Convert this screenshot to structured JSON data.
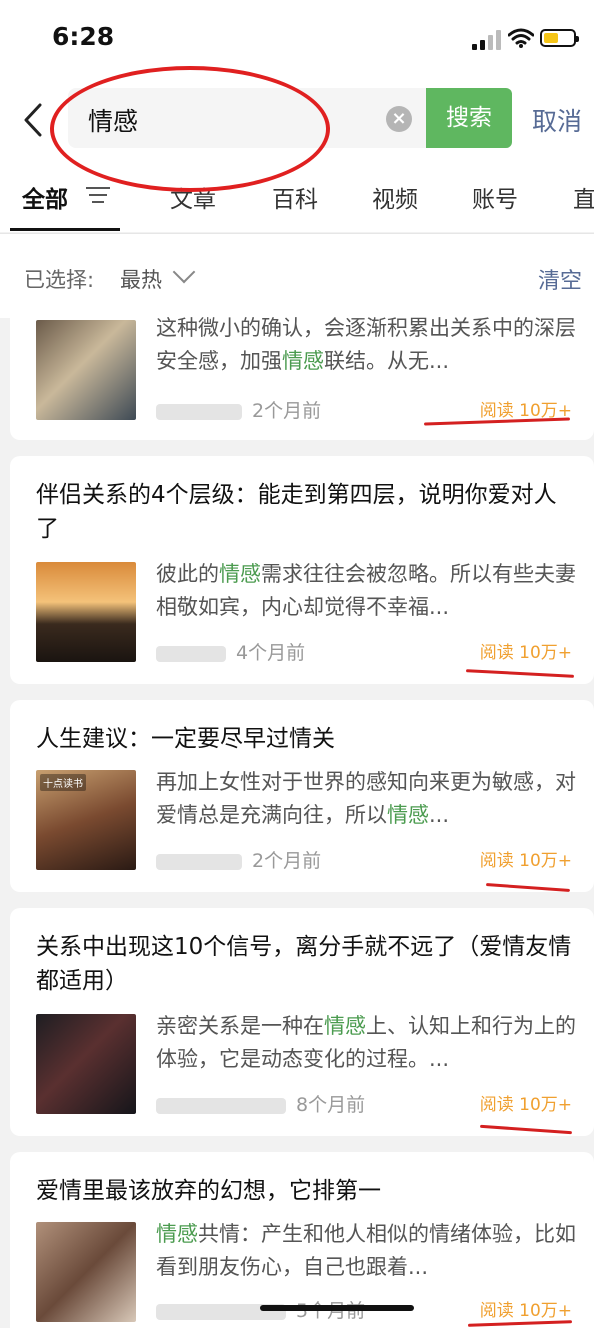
{
  "status": {
    "time": "6:28"
  },
  "search": {
    "query": "情感",
    "search_label": "搜索",
    "cancel_label": "取消"
  },
  "tabs": [
    {
      "label": "全部"
    },
    {
      "label": "文章"
    },
    {
      "label": "百科"
    },
    {
      "label": "视频"
    },
    {
      "label": "账号"
    },
    {
      "label": "直"
    }
  ],
  "filter": {
    "selected_label": "已选择:",
    "selected_value": "最热",
    "clear_label": "清空"
  },
  "results": [
    {
      "title": "",
      "snippet_pre": "这种微小的确认，会逐渐积累出关系中的深层安全感，加强",
      "snippet_hl": "情感",
      "snippet_post": "联结。从无...",
      "time": "2个月前",
      "reads": "阅读 10万+"
    },
    {
      "title": "伴侣关系的4个层级：能走到第四层，说明你爱对人了",
      "snippet_pre": "彼此的",
      "snippet_hl": "情感",
      "snippet_post": "需求往往会被忽略。所以有些夫妻相敬如宾，内心却觉得不幸福...",
      "time": "4个月前",
      "reads": "阅读 10万+"
    },
    {
      "title": "人生建议：一定要尽早过情关",
      "snippet_pre": "再加上女性对于世界的感知向来更为敏感，对爱情总是充满向往，所以",
      "snippet_hl": "情感",
      "snippet_post": "...",
      "time": "2个月前",
      "reads": "阅读 10万+",
      "thumb_badge": "十点读书"
    },
    {
      "title": "关系中出现这10个信号，离分手就不远了（爱情友情都适用）",
      "snippet_pre": "亲密关系是一种在",
      "snippet_hl": "情感",
      "snippet_post": "上、认知上和行为上的体验，它是动态变化的过程。...",
      "time": "8个月前",
      "reads": "阅读 10万+"
    },
    {
      "title": "爱情里最该放弃的幻想，它排第一",
      "snippet_pre": "",
      "snippet_hl": "情感",
      "snippet_post": "共情：产生和他人相似的情绪体验，比如看到朋友伤心，自己也跟着...",
      "time": "5个月前",
      "reads": "阅读 10万+"
    }
  ],
  "colors": {
    "accent_green": "#5fb760",
    "link_blue": "#576b95",
    "highlight_green": "#4b9b4f",
    "reads_orange": "#f0a030",
    "annotation_red": "#e02020"
  }
}
